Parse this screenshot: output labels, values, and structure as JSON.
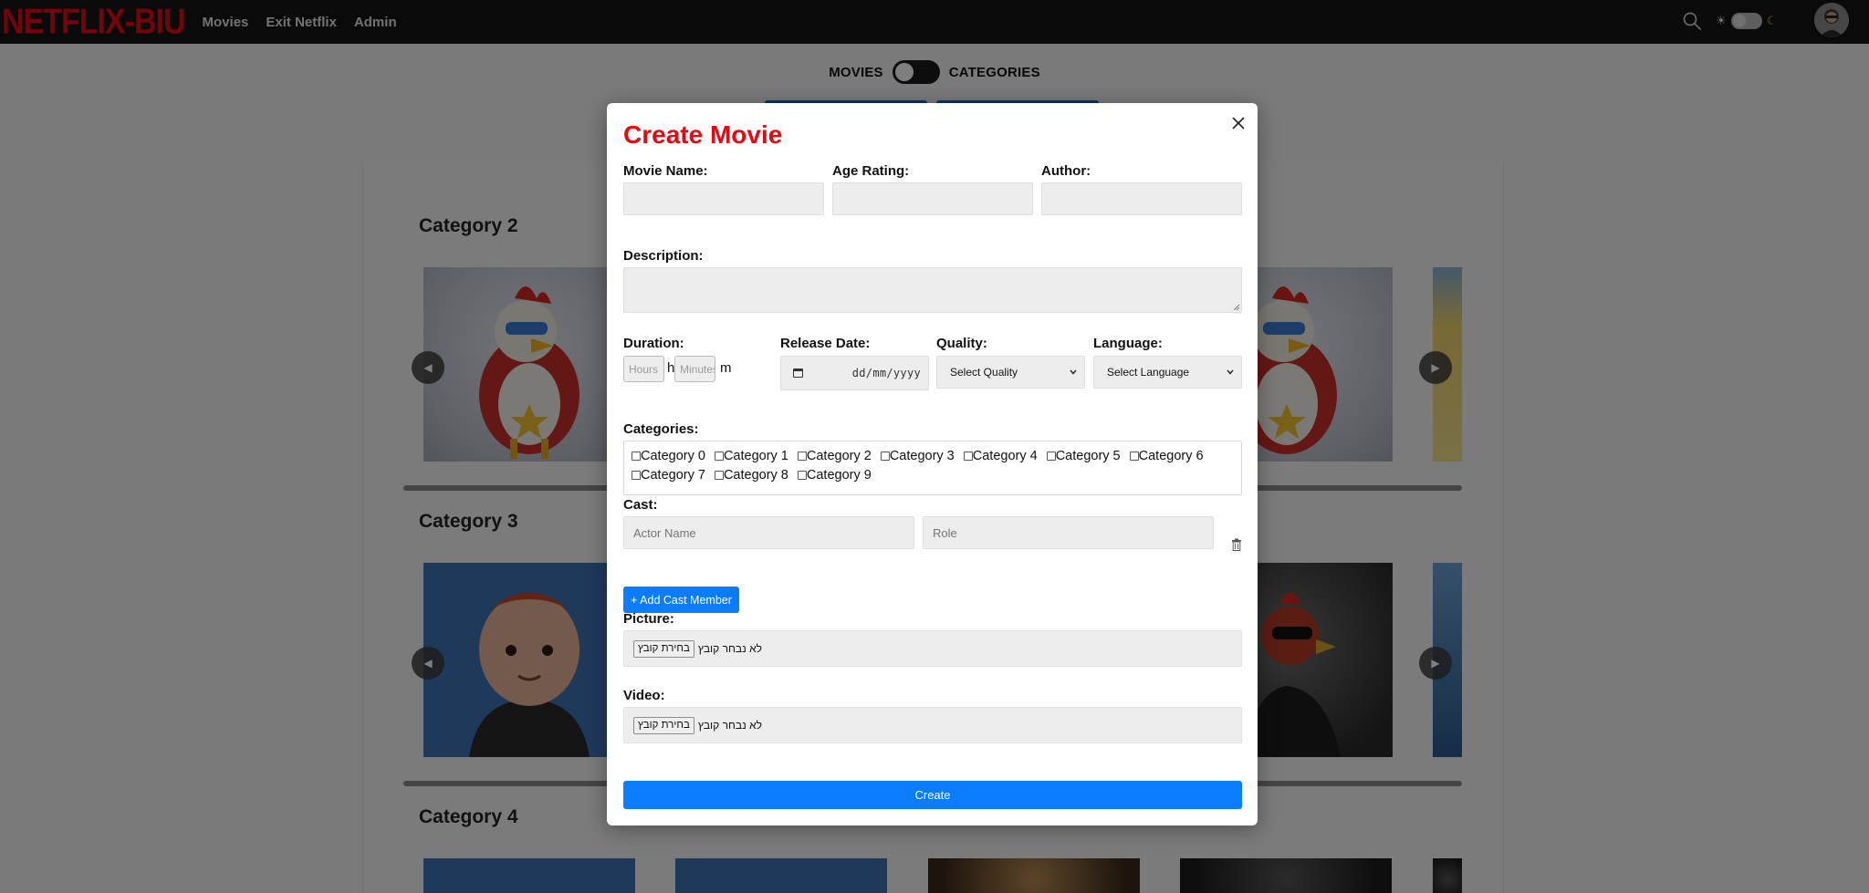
{
  "navbar": {
    "logo": "NETFLIX-BIU",
    "links": [
      "Movies",
      "Exit Netflix",
      "Admin"
    ]
  },
  "page": {
    "toggle_left": "MOVIES",
    "toggle_right": "CATEGORIES",
    "category_titles": [
      "Category 2",
      "Category 3",
      "Category 4"
    ]
  },
  "modal": {
    "title": "Create Movie",
    "movie_name_label": "Movie Name:",
    "age_rating_label": "Age Rating:",
    "author_label": "Author:",
    "description_label": "Description:",
    "duration_label": "Duration:",
    "hours_placeholder": "Hours",
    "minutes_placeholder": "Minutes",
    "hours_unit": "h",
    "minutes_unit": "m",
    "release_date_label": "Release Date:",
    "release_date_value": "dd/mm/yyyy",
    "quality_label": "Quality:",
    "quality_value": "Select Quality",
    "language_label": "Language:",
    "language_value": "Select Language",
    "categories_label": "Categories:",
    "categories": [
      "Category 0",
      "Category 1",
      "Category 2",
      "Category 3",
      "Category 4",
      "Category 5",
      "Category 6",
      "Category 7",
      "Category 8",
      "Category 9"
    ],
    "cast_label": "Cast:",
    "actor_placeholder": "Actor Name",
    "role_placeholder": "Role",
    "add_cast_label": "+ Add Cast Member",
    "picture_label": "Picture:",
    "video_label": "Video:",
    "file_button": "בחירת קובץ",
    "file_status": "לא נבחר קובץ",
    "create_label": "Create"
  },
  "colors": {
    "brand_red": "#e50914",
    "primary_blue": "#0a7cff",
    "navbar_bg": "#141414"
  }
}
